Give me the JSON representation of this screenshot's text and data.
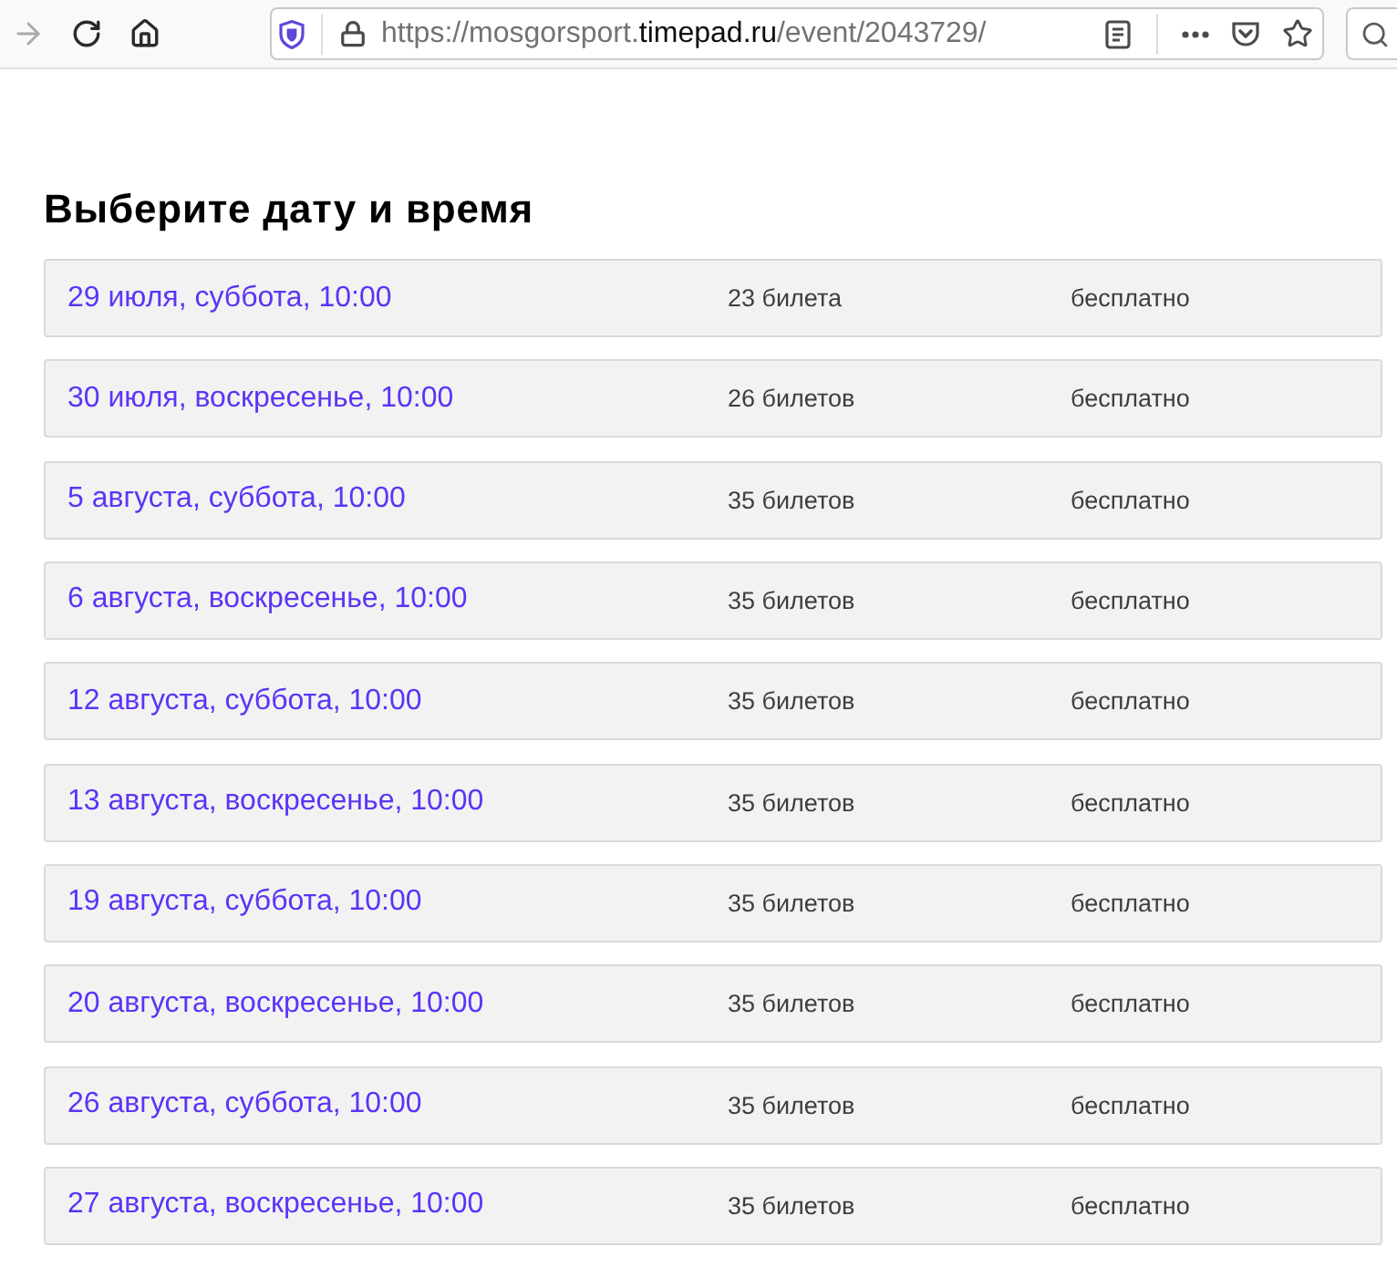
{
  "browser": {
    "nav_buttons": [
      {
        "kind": "forward",
        "disabled": true
      },
      {
        "kind": "reload",
        "disabled": false
      },
      {
        "kind": "home",
        "disabled": false
      }
    ],
    "url": {
      "prefix": "https://mosgorsport.",
      "domain": "timepad.ru",
      "path": "/event/2043729/"
    }
  },
  "page": {
    "title": "Выберите дату и время",
    "sessions": [
      {
        "date": "29 июля, суббота, 10:00",
        "tickets": "23 билета",
        "price": "бесплатно"
      },
      {
        "date": "30 июля, воскресенье, 10:00",
        "tickets": "26 билетов",
        "price": "бесплатно"
      },
      {
        "date": "5 августа, суббота, 10:00",
        "tickets": "35 билетов",
        "price": "бесплатно"
      },
      {
        "date": "6 августа, воскресенье, 10:00",
        "tickets": "35 билетов",
        "price": "бесплатно"
      },
      {
        "date": "12 августа, суббота, 10:00",
        "tickets": "35 билетов",
        "price": "бесплатно"
      },
      {
        "date": "13 августа, воскресенье, 10:00",
        "tickets": "35 билетов",
        "price": "бесплатно"
      },
      {
        "date": "19 августа, суббота, 10:00",
        "tickets": "35 билетов",
        "price": "бесплатно"
      },
      {
        "date": "20 августа, воскресенье, 10:00",
        "tickets": "35 билетов",
        "price": "бесплатно"
      },
      {
        "date": "26 августа, суббота, 10:00",
        "tickets": "35 билетов",
        "price": "бесплатно"
      },
      {
        "date": "27 августа, воскресенье, 10:00",
        "tickets": "35 билетов",
        "price": "бесплатно"
      }
    ]
  }
}
